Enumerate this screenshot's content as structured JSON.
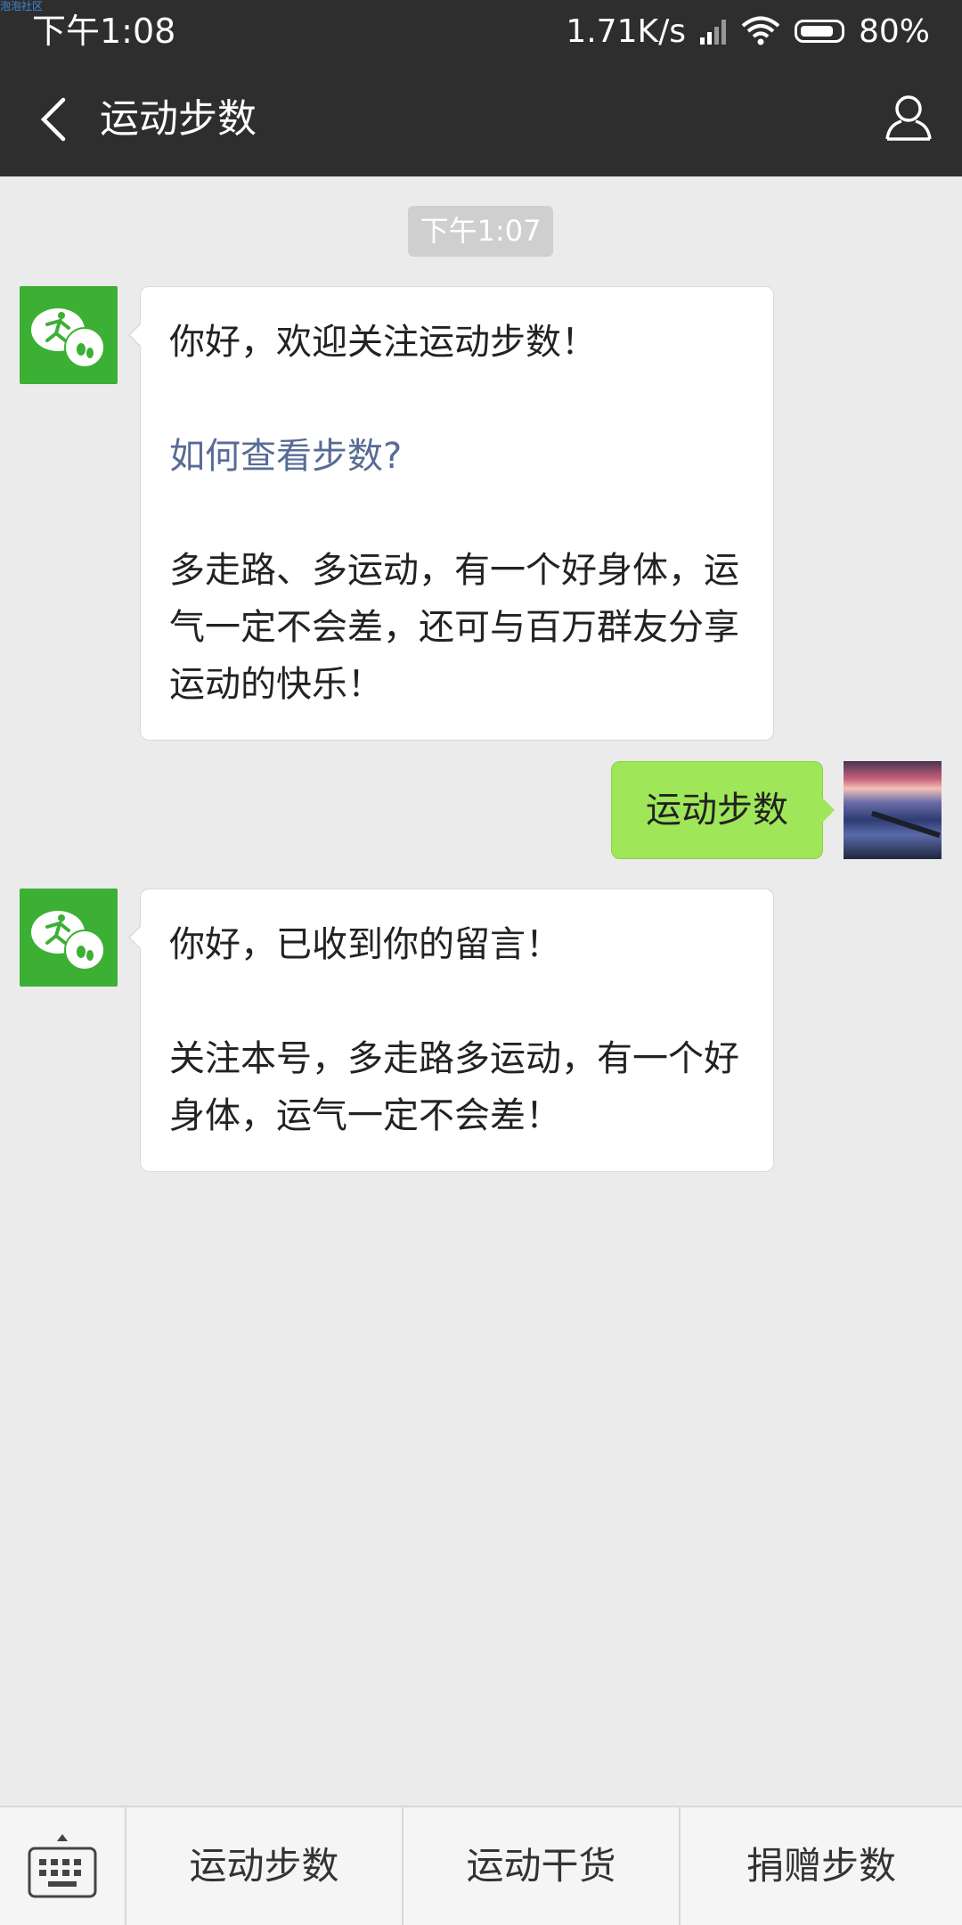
{
  "status_bar": {
    "watermark": "泡泡社区",
    "time": "下午1:08",
    "speed": "1.71K/s",
    "battery": "80%",
    "battery_level": 0.8
  },
  "header": {
    "title": "运动步数",
    "back_icon": "chevron-left-icon",
    "profile_icon": "person-icon"
  },
  "chat": {
    "timestamp": "下午1:07",
    "messages": [
      {
        "from": "bot",
        "paragraphs": [
          "你好，欢迎关注运动步数！",
          "如何查看步数?",
          "多走路、多运动，有一个好身体，运气一定不会差，还可与百万群友分享运动的快乐！"
        ]
      },
      {
        "from": "user",
        "text": "运动步数"
      },
      {
        "from": "bot",
        "paragraphs": [
          "你好，已收到你的留言！",
          "关注本号，多走路多运动，有一个好身体，运气一定不会差！"
        ]
      }
    ]
  },
  "bottom_menu": {
    "keyboard_icon": "keyboard-icon",
    "items": [
      "运动步数",
      "运动干货",
      "捐赠步数"
    ]
  },
  "colors": {
    "header_bg": "#2e2e2e",
    "chat_bg": "#ebebeb",
    "bot_avatar": "#3cb035",
    "user_bubble": "#9fe658",
    "link": "#576b95"
  }
}
